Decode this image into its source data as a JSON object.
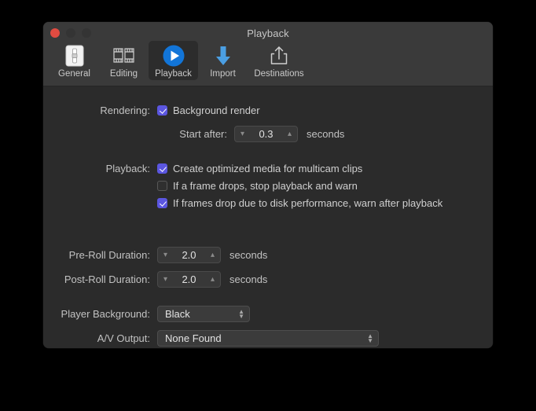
{
  "window": {
    "title": "Playback",
    "traffic_lights": [
      "close",
      "minimize",
      "zoom"
    ],
    "accent_checkbox_color": "#5b56e0",
    "toolbar_bg": "#3a3a3a",
    "body_bg": "#2b2b2b"
  },
  "toolbar": {
    "tabs": [
      {
        "label": "General",
        "icon": "slider-panel-icon",
        "selected": false
      },
      {
        "label": "Editing",
        "icon": "filmstrip-icon",
        "selected": false
      },
      {
        "label": "Playback",
        "icon": "play-circle-icon",
        "selected": true
      },
      {
        "label": "Import",
        "icon": "down-arrow-icon",
        "selected": false
      },
      {
        "label": "Destinations",
        "icon": "share-export-icon",
        "selected": false
      }
    ]
  },
  "rendering": {
    "label": "Rendering:",
    "background_render": {
      "label": "Background render",
      "checked": true
    },
    "start_after": {
      "label": "Start after:",
      "value": "0.3",
      "unit": "seconds",
      "decrement_icon": "chevron-down-icon",
      "increment_icon": "chevron-up-icon"
    }
  },
  "playback": {
    "label": "Playback:",
    "options": [
      {
        "label": "Create optimized media for multicam clips",
        "checked": true
      },
      {
        "label": "If a frame drops, stop playback and warn",
        "checked": false
      },
      {
        "label": "If frames drop due to disk performance, warn after playback",
        "checked": true
      }
    ]
  },
  "pre_roll": {
    "label": "Pre-Roll Duration:",
    "value": "2.0",
    "unit": "seconds"
  },
  "post_roll": {
    "label": "Post-Roll Duration:",
    "value": "2.0",
    "unit": "seconds"
  },
  "player_background": {
    "label": "Player Background:",
    "value": "Black"
  },
  "av_output": {
    "label": "A/V Output:",
    "value": "None Found"
  }
}
